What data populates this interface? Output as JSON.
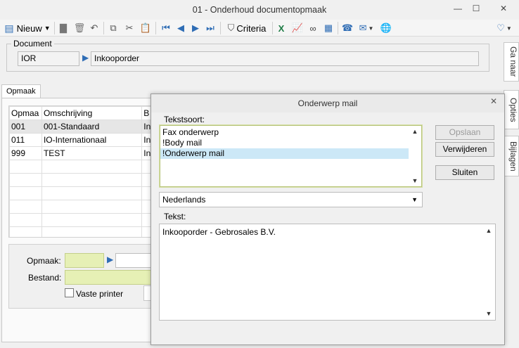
{
  "window": {
    "title": "01 - Onderhoud documentopmaak",
    "minimize": "—",
    "maximize": "☐",
    "close": "✕"
  },
  "toolbar": {
    "new_label": "Nieuw",
    "criteria_label": "Criteria",
    "icons": [
      "document-icon",
      "save-icon",
      "delete-icon",
      "undo-icon",
      "copy-icon",
      "cut-icon",
      "paste-icon",
      "first-icon",
      "previous-icon",
      "next-icon",
      "last-icon",
      "filter-icon",
      "excel-icon",
      "chart-icon",
      "binoculars-icon",
      "table-icon",
      "phone-icon",
      "mail-icon",
      "globe-icon",
      "favorite-icon"
    ]
  },
  "document": {
    "legend": "Document",
    "code": "IOR",
    "description": "Inkooporder"
  },
  "tabs": {
    "opmaak": "Opmaak"
  },
  "grid": {
    "headers": [
      "Opmaa",
      "Omschrijving",
      "B"
    ],
    "rows": [
      [
        "001",
        "001-Standaard",
        "In"
      ],
      [
        "011",
        "IO-Internationaal",
        "In"
      ],
      [
        "999",
        "TEST",
        "In"
      ]
    ]
  },
  "form": {
    "opmaak_label": "Opmaak:",
    "bestand_label": "Bestand:",
    "vaste_printer_label": "Vaste printer"
  },
  "sidetabs": {
    "ga_naar": "Ga naar",
    "opties": "Opties",
    "bijlagen": "Bijlagen"
  },
  "dialog": {
    "title": "Onderwerp mail",
    "close": "✕",
    "tekstsoort_label": "Tekstsoort:",
    "tekstsoort_items": [
      "Fax onderwerp",
      "!Body mail",
      "!Onderwerp mail"
    ],
    "selected_index": 2,
    "language": "Nederlands",
    "tekst_label": "Tekst:",
    "tekst_value": "Inkooporder - Gebrosales B.V.",
    "buttons": {
      "opslaan": "Opslaan",
      "verwijderen": "Verwijderen",
      "sluiten": "Sluiten"
    }
  },
  "colors": {
    "accent": "#2f6db5",
    "selection": "#cce8f7",
    "required_field": "#e6f0b5"
  }
}
